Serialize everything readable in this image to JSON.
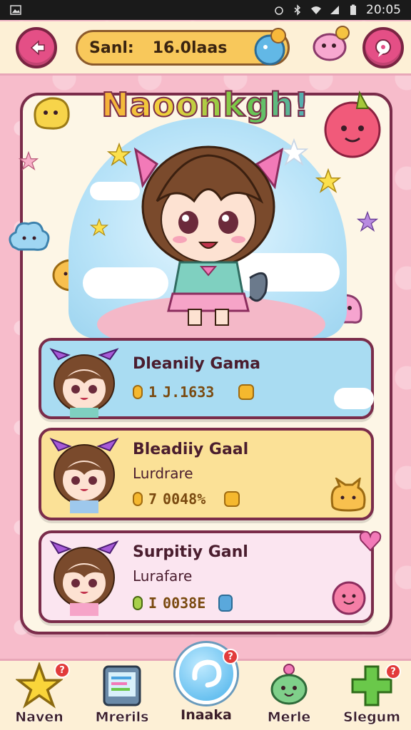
{
  "status_bar": {
    "time": "20:05"
  },
  "top_bar": {
    "search_label": "Sanl:",
    "search_value": "16.0laas"
  },
  "hero": {
    "title": "Naoonkgh!"
  },
  "games": [
    {
      "title": "Dleanily Gama",
      "subtitle": "",
      "stat_count": "1",
      "stat_value": "J.1633"
    },
    {
      "title": "Bleadiiy Gaal",
      "subtitle": "Lurdrare",
      "stat_count": "7",
      "stat_value": "0048%"
    },
    {
      "title": "Surpitiy Ganl",
      "subtitle": "Lurafare",
      "stat_count": "I",
      "stat_value": "0038E"
    }
  ],
  "nav": [
    {
      "label": "Naven",
      "badge": "?"
    },
    {
      "label": "Mrerils",
      "badge": ""
    },
    {
      "label": "Inaaka",
      "badge": "?"
    },
    {
      "label": "Merle",
      "badge": ""
    },
    {
      "label": "Slegum",
      "badge": "?"
    }
  ],
  "icons": {
    "back": "back-arrow-icon",
    "chat": "chat-bubble-icon",
    "star": "star-icon",
    "tablet": "tablet-icon",
    "swirl": "swirl-icon",
    "mascot": "mascot-icon",
    "plus": "plus-icon"
  },
  "colors": {
    "accent_pink": "#e44f86",
    "card_blue": "#a9dcf2",
    "card_yellow": "#fbe197",
    "card_pink": "#fbe5f0",
    "outline": "#7a2c4a"
  }
}
